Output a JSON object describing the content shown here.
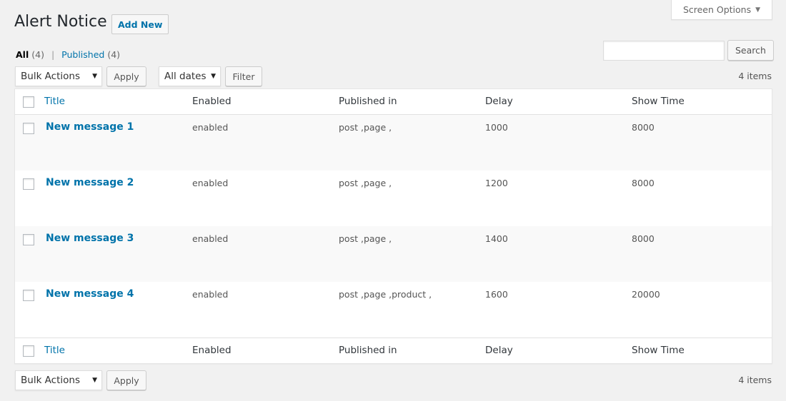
{
  "header": {
    "screen_options_label": "Screen Options",
    "page_title": "Alert Notice",
    "add_new_label": "Add New"
  },
  "views": {
    "all_label": "All",
    "all_count": "(4)",
    "separator": "|",
    "published_label": "Published",
    "published_count": "(4)"
  },
  "search": {
    "value": "",
    "placeholder": "",
    "button_label": "Search"
  },
  "top_nav": {
    "bulk_actions": "Bulk Actions",
    "apply_label": "Apply",
    "dates_filter": "All dates",
    "filter_label": "Filter",
    "item_count": "4 items"
  },
  "bottom_nav": {
    "bulk_actions": "Bulk Actions",
    "apply_label": "Apply",
    "item_count": "4 items"
  },
  "table": {
    "columns": [
      "Title",
      "Enabled",
      "Published in",
      "Delay",
      "Show Time"
    ],
    "rows": [
      {
        "title": "New message 1",
        "enabled": "enabled",
        "published_in": "post ,page ,",
        "delay": "1000",
        "show_time": "8000"
      },
      {
        "title": "New message 2",
        "enabled": "enabled",
        "published_in": "post ,page ,",
        "delay": "1200",
        "show_time": "8000"
      },
      {
        "title": "New message 3",
        "enabled": "enabled",
        "published_in": "post ,page ,",
        "delay": "1400",
        "show_time": "8000"
      },
      {
        "title": "New message 4",
        "enabled": "enabled",
        "published_in": "post ,page ,product ,",
        "delay": "1600",
        "show_time": "20000"
      }
    ]
  },
  "icons": {
    "dropdown_caret": "▼"
  }
}
